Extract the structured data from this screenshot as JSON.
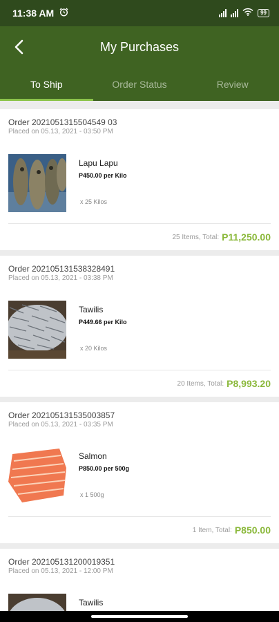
{
  "status_bar": {
    "time": "11:38 AM",
    "battery": "99"
  },
  "header": {
    "title": "My Purchases"
  },
  "tabs": [
    {
      "label": "To Ship",
      "active": true
    },
    {
      "label": "Order Status",
      "active": false
    },
    {
      "label": "Review",
      "active": false
    }
  ],
  "orders": [
    {
      "order_id": "Order 2021051315504549 03",
      "placed": "Placed on 05.13, 2021 - 03:50 PM",
      "item_name": "Lapu Lapu",
      "item_price": "P450.00 per Kilo",
      "item_qty": "x 25 Kilos",
      "total_label": "25 Items, Total:",
      "total_amount": "P11,250.00",
      "image": "lapu-lapu-fish"
    },
    {
      "order_id": "Order 202105131538328491",
      "placed": "Placed on 05.13, 2021 - 03:38 PM",
      "item_name": "Tawilis",
      "item_price": "P449.66 per Kilo",
      "item_qty": "x 20 Kilos",
      "total_label": "20 Items, Total:",
      "total_amount": "P8,993.20",
      "image": "tawilis-fish"
    },
    {
      "order_id": "Order 202105131535003857",
      "placed": "Placed on 05.13, 2021 - 03:35 PM",
      "item_name": "Salmon",
      "item_price": "P850.00 per 500g",
      "item_qty": "x 1 500g",
      "total_label": "1 Item, Total:",
      "total_amount": "P850.00",
      "image": "salmon-fillet"
    },
    {
      "order_id": "Order 202105131200019351",
      "placed": "Placed on 05.13, 2021 - 12:00 PM",
      "item_name": "Tawilis",
      "image": "tawilis-fish"
    }
  ]
}
